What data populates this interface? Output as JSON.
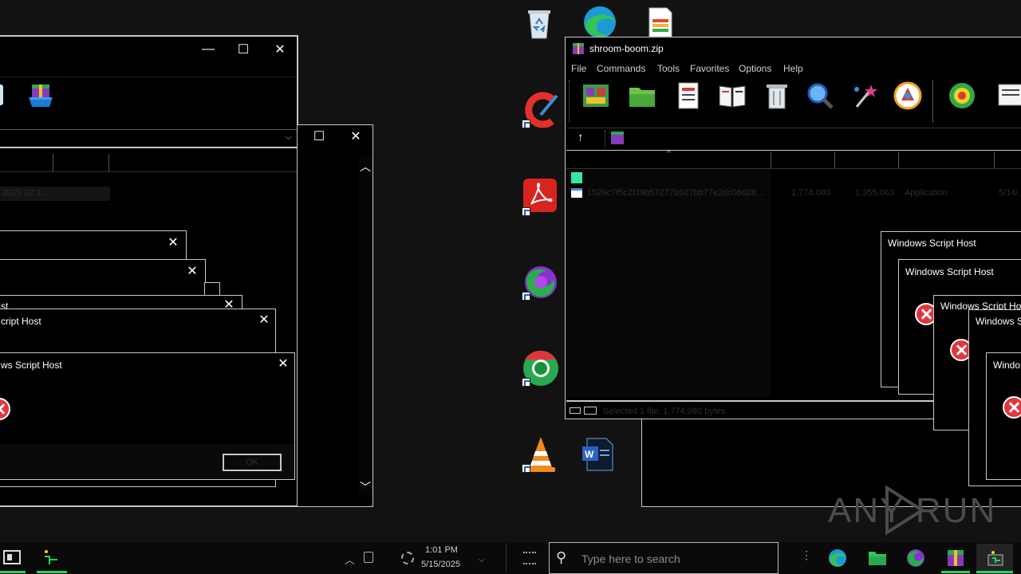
{
  "desktop": {
    "icons": [
      "recycle-bin",
      "edge",
      "word-document",
      "ccleaner",
      "acrobat",
      "firefox",
      "chrome",
      "vlc",
      "word-file"
    ]
  },
  "left_window": {
    "minimize": "—",
    "maximize": "☐",
    "close": "✕",
    "date_fragment": "2025 12:3..."
  },
  "mid_window": {
    "maximize": "☐",
    "close": "✕"
  },
  "left_dialogs": [
    {
      "title": "",
      "close": "✕"
    },
    {
      "title": "",
      "close": "✕"
    },
    {
      "title": "st",
      "close": "✕"
    },
    {
      "title": "cript Host",
      "close": "✕"
    },
    {
      "title": "ws Script Host",
      "close": "✕",
      "button": "OK"
    }
  ],
  "winrar": {
    "title": "shroom-boom.zip",
    "menu": [
      "File",
      "Commands",
      "Tools",
      "Favorites",
      "Options",
      "Help"
    ],
    "file_row": {
      "name": "1529c7f5c2f39b57277b507bb77e2dc06d28...",
      "size": "1,774,080",
      "packed": "1,355,063",
      "type": "Application",
      "modified": "5/14/..."
    },
    "status": "Selected 1 file, 1,774,080 bytes"
  },
  "right_dialogs": [
    {
      "title": "Windows Script Host"
    },
    {
      "title": "Windows Script Host"
    },
    {
      "title": "Windows Script Ho"
    },
    {
      "title": "Windows S"
    },
    {
      "title": "Windo"
    }
  ],
  "watermark": "ANY RUN",
  "taskbar": {
    "search_placeholder": "Type here to search",
    "time": "1:01 PM",
    "date": "5/15/2025"
  },
  "colors": {
    "background": "#121212",
    "window": "#000000",
    "accent_green": "#1ed760",
    "error_red": "#e2353b"
  }
}
